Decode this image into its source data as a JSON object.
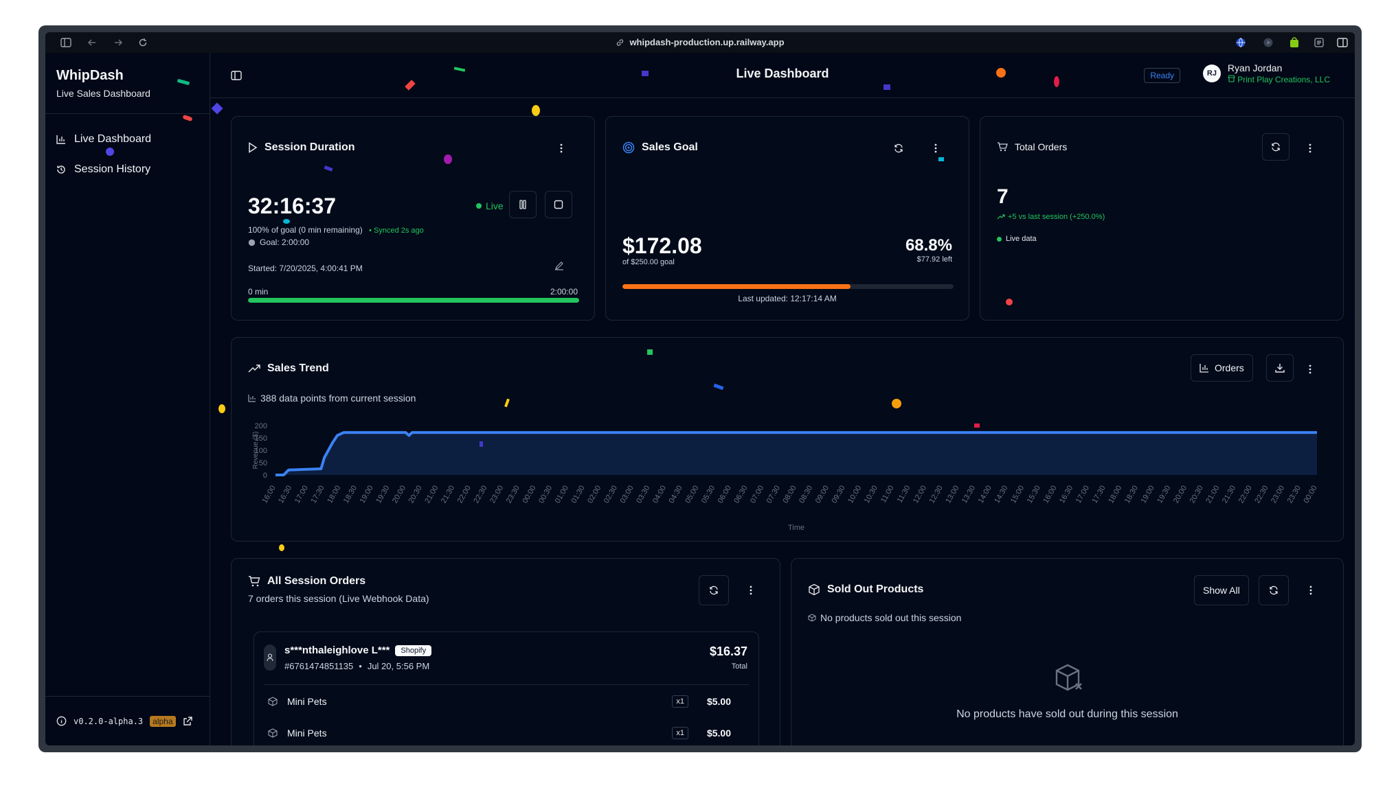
{
  "browser": {
    "url": "whipdash-production.up.railway.app"
  },
  "sidebar": {
    "brand_title": "WhipDash",
    "brand_subtitle": "Live Sales Dashboard",
    "items": [
      {
        "label": "Live Dashboard",
        "icon": "bar-chart-icon"
      },
      {
        "label": "Session History",
        "icon": "history-icon"
      }
    ],
    "version": "v0.2.0-alpha.3",
    "badge": "alpha"
  },
  "header": {
    "title": "Live Dashboard",
    "status": "Ready",
    "user_initials": "RJ",
    "user_name": "Ryan Jordan",
    "company": "Print Play Creations, LLC"
  },
  "session": {
    "title": "Session Duration",
    "time": "32:16:37",
    "live": "Live",
    "goal_text": "100% of goal (0 min remaining)",
    "synced": "• Synced 2s ago",
    "goal": "Goal: 2:00:00",
    "started": "Started: 7/20/2025, 4:00:41 PM",
    "bar_start": "0 min",
    "bar_end": "2:00:00",
    "progress": 1.0
  },
  "sales_goal": {
    "title": "Sales Goal",
    "amount": "$172.08",
    "of_goal": "of $250.00 goal",
    "percent": "68.8%",
    "left": "$77.92 left",
    "updated": "Last updated: 12:17:14 AM",
    "progress": 0.688,
    "color": "#f97316"
  },
  "orders_total": {
    "title": "Total Orders",
    "count": "7",
    "delta": "+5 vs last session (+250.0%)",
    "live": "Live data"
  },
  "trend": {
    "title": "Sales Trend",
    "subtitle": "388 data points from current session",
    "orders_button": "Orders"
  },
  "chart_data": {
    "type": "area",
    "ylabel": "Revenue ($)",
    "xlabel": "Time",
    "ylim": [
      0,
      200
    ],
    "yticks": [
      0,
      50,
      100,
      150,
      200
    ],
    "grid": false,
    "color": "#3b82f6",
    "x_labels": [
      "16:00",
      "16:30",
      "17:00",
      "17:30",
      "18:00",
      "18:30",
      "19:00",
      "19:30",
      "20:00",
      "20:30",
      "21:00",
      "21:30",
      "22:00",
      "22:30",
      "23:00",
      "23:30",
      "00:00",
      "00:30",
      "01:00",
      "01:30",
      "02:00",
      "02:30",
      "03:00",
      "03:30",
      "04:00",
      "04:30",
      "05:00",
      "05:30",
      "06:00",
      "06:30",
      "07:00",
      "07:30",
      "08:00",
      "08:30",
      "09:00",
      "09:30",
      "10:00",
      "10:30",
      "11:00",
      "11:30",
      "12:00",
      "12:30",
      "13:00",
      "13:30",
      "14:00",
      "14:30",
      "15:00",
      "15:30",
      "16:00",
      "16:30",
      "17:00",
      "17:30",
      "18:00",
      "18:30",
      "19:00",
      "19:30",
      "20:00",
      "20:30",
      "21:00",
      "21:30",
      "22:00",
      "22:30",
      "23:00",
      "23:30",
      "00:00"
    ],
    "series": [
      {
        "points": [
          [
            0,
            0
          ],
          [
            0.5,
            0
          ],
          [
            0.8,
            20
          ],
          [
            1.5,
            22
          ],
          [
            2.8,
            25
          ],
          [
            3.0,
            70
          ],
          [
            3.5,
            130
          ],
          [
            3.8,
            160
          ],
          [
            4.2,
            172
          ],
          [
            8,
            172
          ],
          [
            8.2,
            160
          ],
          [
            8.4,
            172
          ],
          [
            64,
            172
          ]
        ]
      }
    ]
  },
  "all_orders": {
    "title": "All Session Orders",
    "subtitle": "7 orders this session (Live Webhook Data)",
    "order": {
      "customer": "s***nthaleighlove L***",
      "source": "Shopify",
      "number": "#6761474851135",
      "sep": "•",
      "date": "Jul 20, 5:56 PM",
      "total": "$16.37",
      "total_label": "Total",
      "items": [
        {
          "name": "Mini Pets",
          "qty": "x1",
          "price": "$5.00"
        },
        {
          "name": "Mini Pets",
          "qty": "x1",
          "price": "$5.00"
        }
      ]
    }
  },
  "sold_out": {
    "title": "Sold Out Products",
    "show_all": "Show All",
    "subtitle": "No products sold out this session",
    "empty": "No products have sold out during this session"
  }
}
